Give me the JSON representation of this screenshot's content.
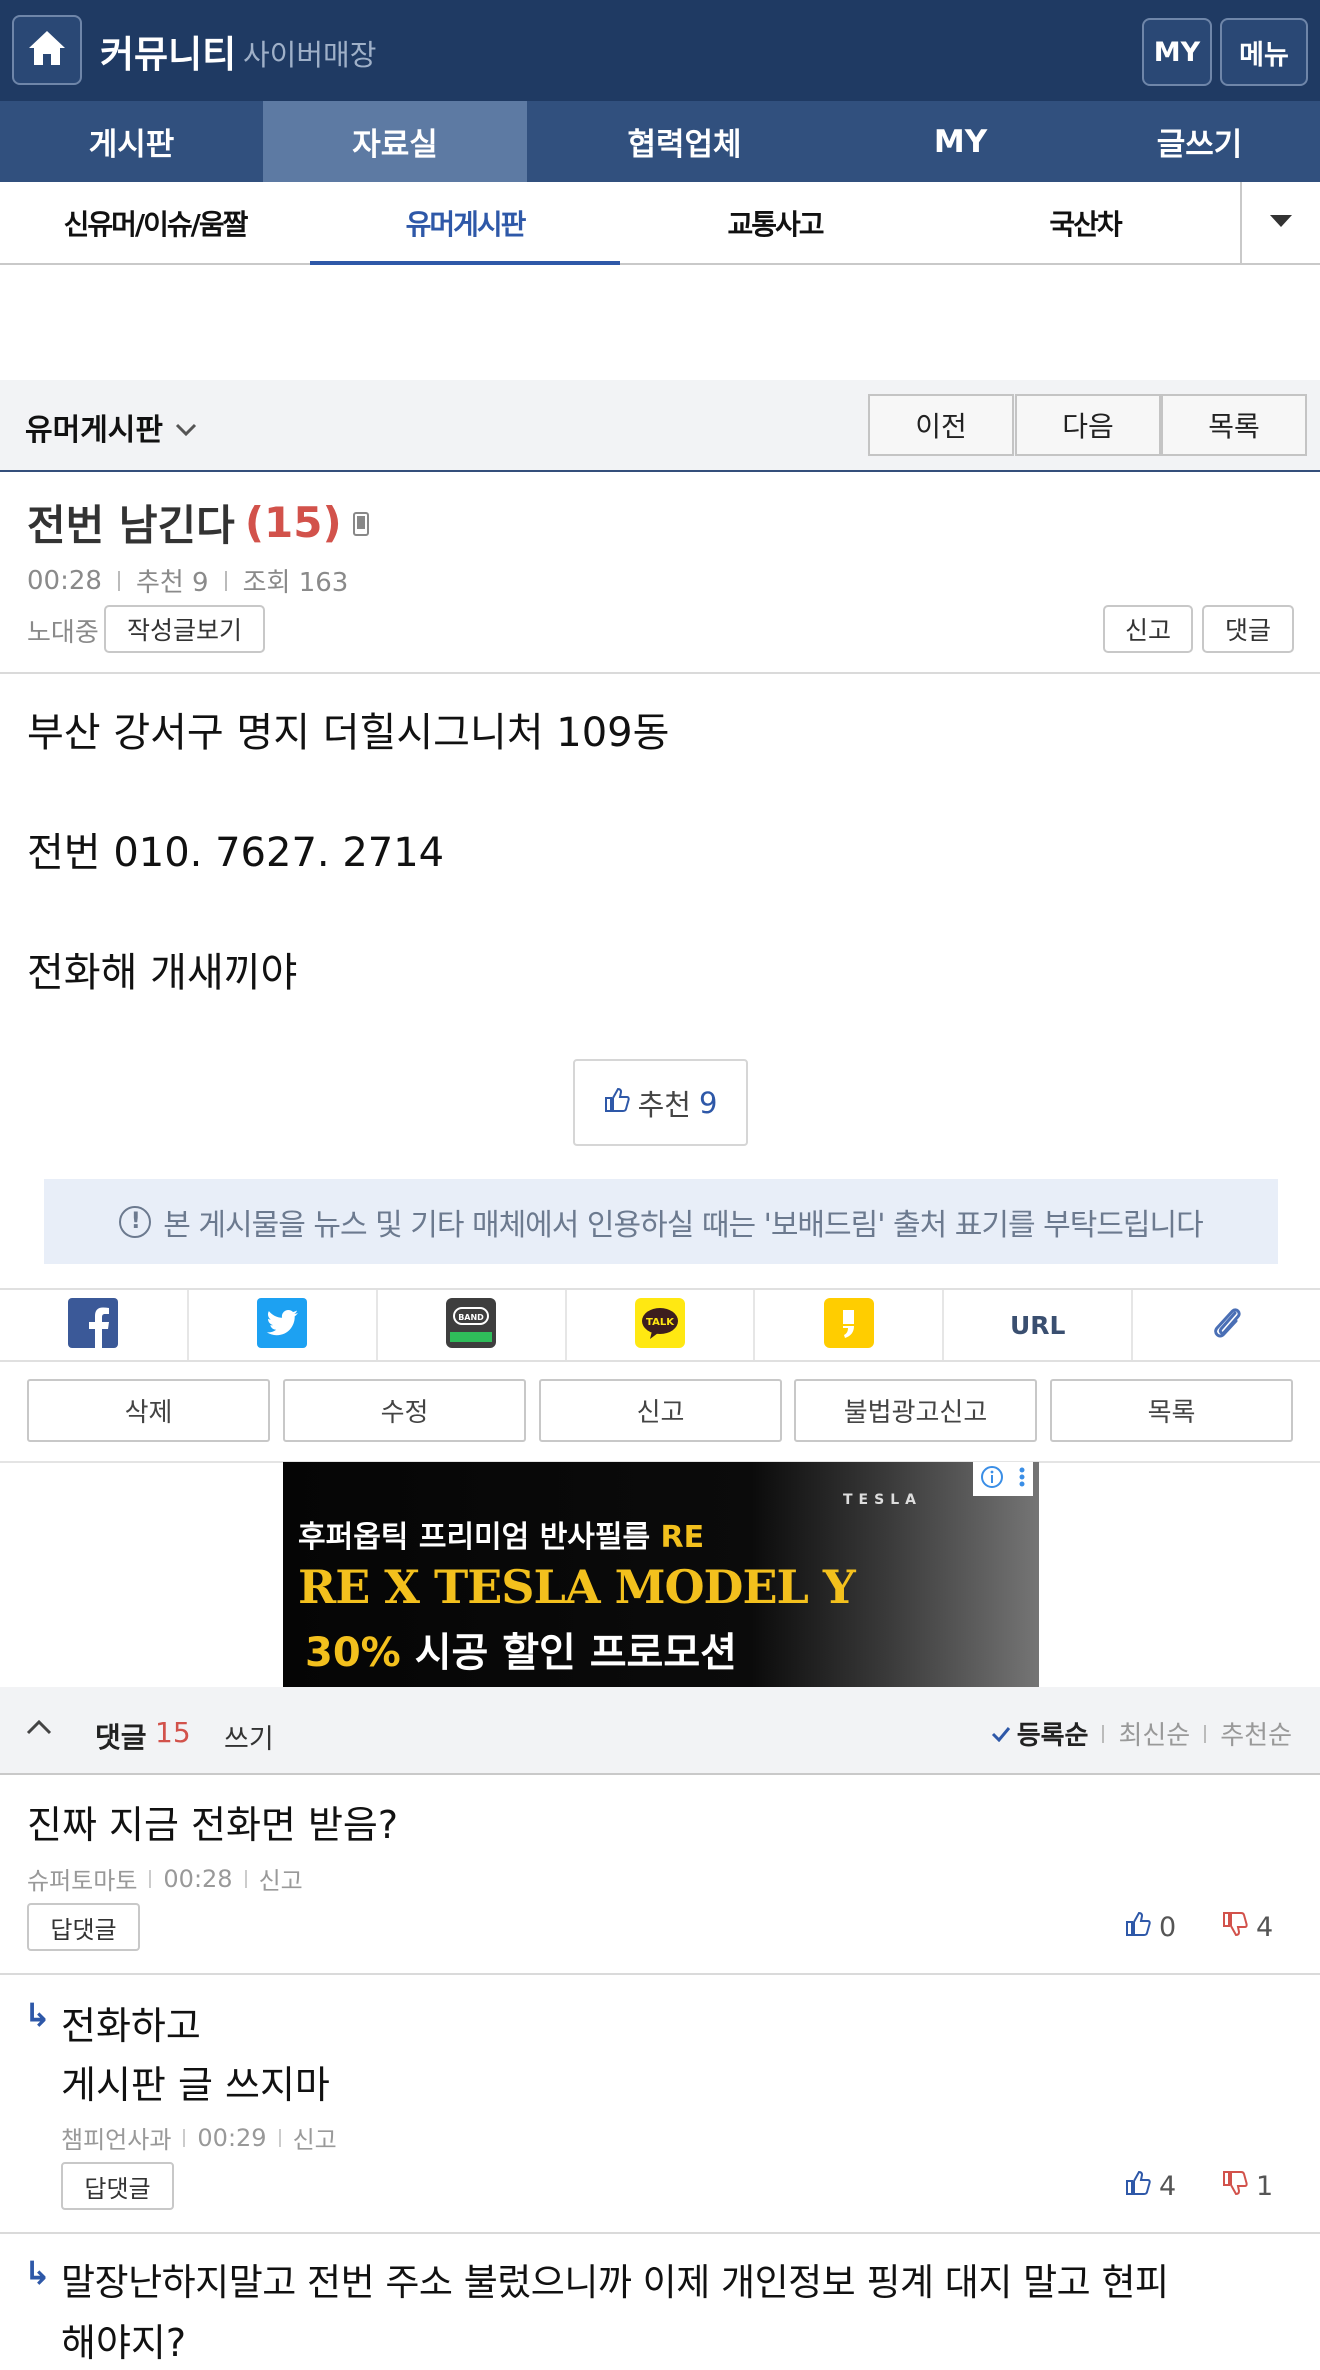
{
  "header": {
    "title": "커뮤니티",
    "subtitle": "사이버매장",
    "my_label": "MY",
    "menu_label": "메뉴"
  },
  "main_nav": [
    {
      "label": "게시판",
      "active": false
    },
    {
      "label": "자료실",
      "active": true
    },
    {
      "label": "협력업체",
      "active": false
    },
    {
      "label": "MY",
      "active": false
    },
    {
      "label": "글쓰기",
      "active": false
    }
  ],
  "sub_nav": [
    {
      "label": "신유머/이슈/움짤",
      "active": false
    },
    {
      "label": "유머게시판",
      "active": true
    },
    {
      "label": "교통사고",
      "active": false
    },
    {
      "label": "국산차",
      "active": false
    }
  ],
  "board": {
    "name": "유머게시판",
    "prev_label": "이전",
    "next_label": "다음",
    "list_label": "목록"
  },
  "post": {
    "title": "전번 남긴다",
    "comment_count": "(15)",
    "time": "00:28",
    "recommend": "추천 9",
    "views": "조회 163",
    "author": "노대중",
    "view_posts_label": "작성글보기",
    "report_label": "신고",
    "comment_label": "댓글",
    "body": [
      "부산 강서구 명지 더힐시그니처 109동",
      "전번 010. 7627. 2714",
      "전화해 개새끼야"
    ],
    "rec_label": "추천",
    "rec_count": "9",
    "notice": "본 게시물을 뉴스 및 기타 매체에서 인용하실 때는 '보배드림' 출처 표기를 부탁드립니다"
  },
  "share": {
    "url_label": "URL",
    "icons": [
      "facebook-icon",
      "twitter-icon",
      "band-icon",
      "kakaotalk-icon",
      "kakaostory-icon",
      "url-icon",
      "clip-icon"
    ],
    "colors": {
      "facebook": "#3b5998",
      "twitter": "#1da1f2",
      "band": "#3e3e3e",
      "kakao": "#ffe812"
    }
  },
  "actions": [
    "삭제",
    "수정",
    "신고",
    "불법광고신고",
    "목록"
  ],
  "ad": {
    "line1": "후퍼옵틱 프리미엄 반사필름",
    "line1_accent": "RE",
    "line2": "RE X TESLA MODEL Y",
    "line3_accent": "30%",
    "line3": "시공 할인 프로모션",
    "brand": "TESLA"
  },
  "comments_header": {
    "label": "댓글",
    "count": "15",
    "write_label": "쓰기",
    "sort_registered": "등록순",
    "sort_latest": "최신순",
    "sort_recommended": "추천순"
  },
  "comments": [
    {
      "text_lines": [
        "진짜 지금 전화면 받음?"
      ],
      "author": "슈퍼토마토",
      "time": "00:28",
      "report": "신고",
      "reply_label": "답댓글",
      "likes": "0",
      "dislikes": "4"
    },
    {
      "text_lines": [
        "전화하고",
        "게시판 글 쓰지마"
      ],
      "author": "챔피언사과",
      "time": "00:29",
      "report": "신고",
      "reply_label": "답댓글",
      "likes": "4",
      "dislikes": "1"
    },
    {
      "text_lines": [
        "말장난하지말고 전번 주소 불렀으니까 이제 개인정보 핑계 대지 말고 현피",
        "해야지?"
      ]
    }
  ],
  "colors": {
    "header_bg": "#1f3a63",
    "nav_bg": "#31507e",
    "nav_active": "#5d7aa3",
    "accent_blue": "#2e58a8",
    "accent_red": "#d2524b"
  }
}
